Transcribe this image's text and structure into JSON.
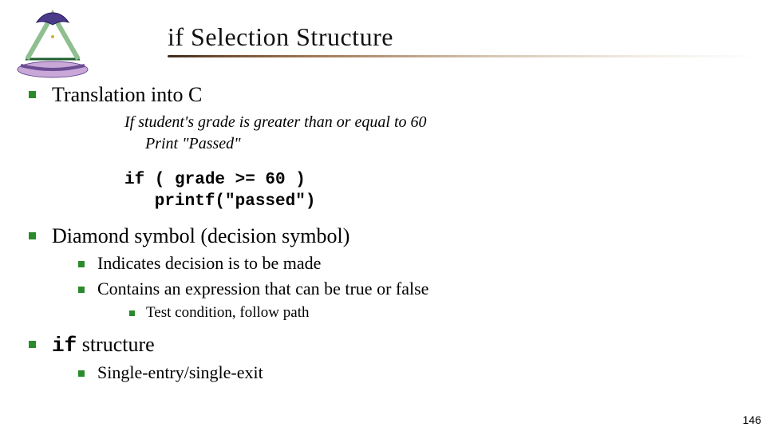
{
  "title": "if Selection Structure",
  "bullets": {
    "b1a": "Translation into C",
    "pseudo1": "If student's grade is greater than or equal to 60",
    "pseudo2": "Print \"Passed\"",
    "code1": "if ( grade >= 60 )",
    "code2": "   printf(\"passed\")",
    "b1b": "Diamond symbol (decision symbol)",
    "b2a": "Indicates decision is to be made",
    "b2b": "Contains an expression that can be true or false",
    "b3a": "Test condition, follow path",
    "b1c_code": "if",
    "b1c_rest": " structure",
    "b2c": "Single-entry/single-exit"
  },
  "page_number": "146"
}
